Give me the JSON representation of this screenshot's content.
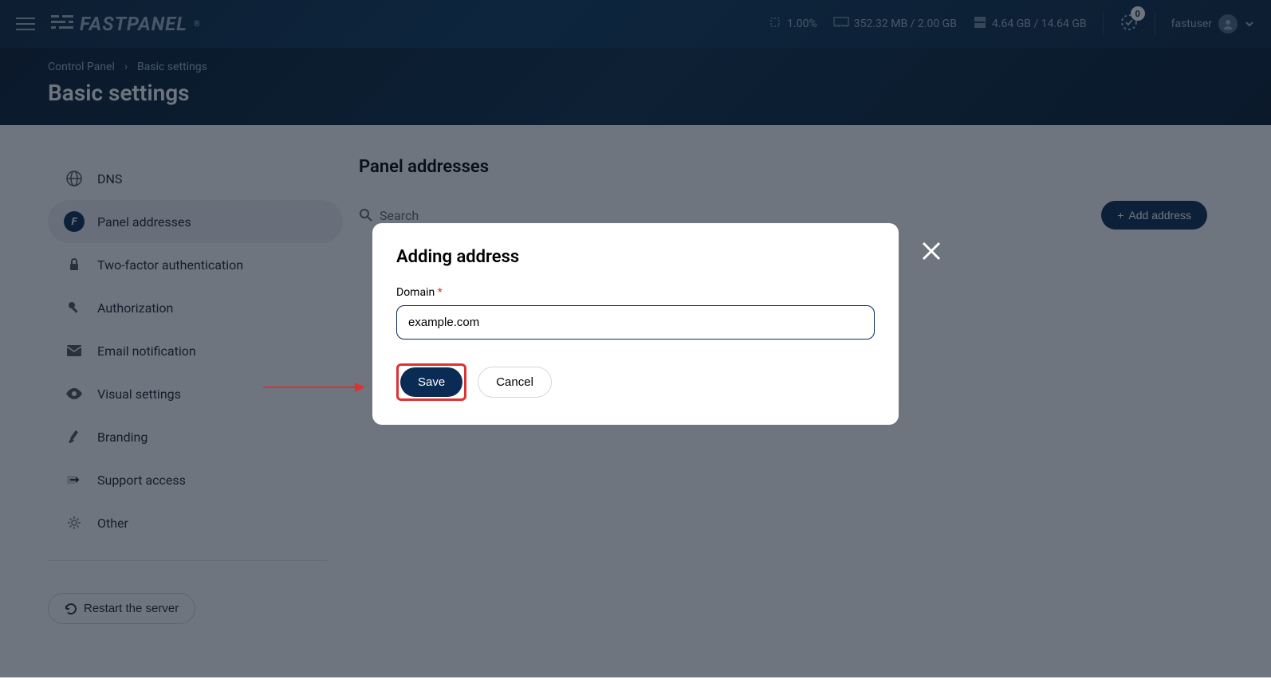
{
  "header": {
    "logo": "FASTPANEL",
    "cpu": "1.00%",
    "ram": "352.32 MB / 2.00 GB",
    "disk": "4.64 GB / 14.64 GB",
    "notifications": "0",
    "username": "fastuser"
  },
  "breadcrumb": {
    "root": "Control Panel",
    "current": "Basic settings"
  },
  "page_title": "Basic settings",
  "sidebar": {
    "items": [
      {
        "label": "DNS"
      },
      {
        "label": "Panel addresses"
      },
      {
        "label": "Two-factor authentication"
      },
      {
        "label": "Authorization"
      },
      {
        "label": "Email notification"
      },
      {
        "label": "Visual settings"
      },
      {
        "label": "Branding"
      },
      {
        "label": "Support access"
      },
      {
        "label": "Other"
      }
    ],
    "restart": "Restart the server"
  },
  "content": {
    "title": "Panel addresses",
    "search": "Search",
    "add": "Add address"
  },
  "modal": {
    "title": "Adding address",
    "domain_label": "Domain",
    "domain_value": "example.com",
    "save": "Save",
    "cancel": "Cancel"
  }
}
